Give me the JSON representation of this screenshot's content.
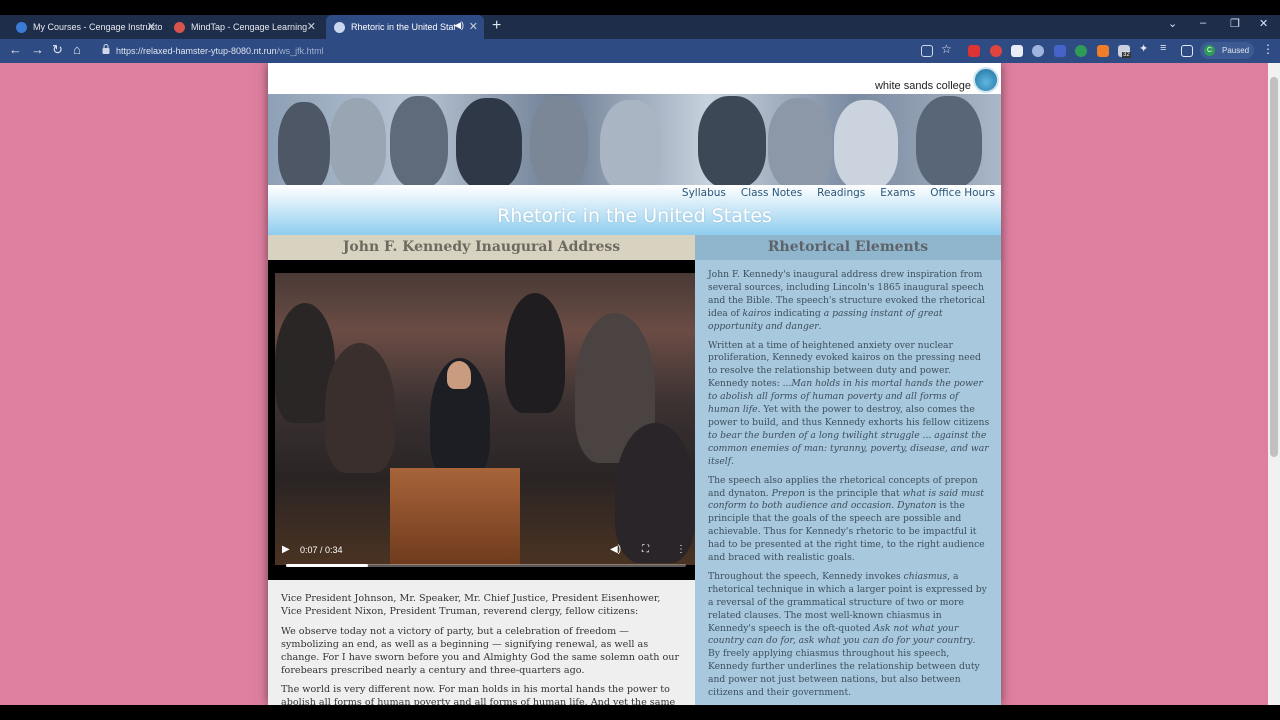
{
  "browser": {
    "tabs": [
      {
        "title": "My Courses - Cengage Instructor",
        "active": false
      },
      {
        "title": "MindTap - Cengage Learning",
        "active": false
      },
      {
        "title": "Rhetoric in the United States",
        "active": true
      }
    ],
    "url_host": "https://relaxed-hamster-ytup-8080.nt.run",
    "url_path": "/ws_jfk.html",
    "profile_initial": "C",
    "profile_status": "Paused",
    "extension_badge": "32"
  },
  "site": {
    "college_name": "white sands college",
    "title": "Rhetoric in the United States",
    "nav": [
      "Syllabus",
      "Class Notes",
      "Readings",
      "Exams",
      "Office Hours"
    ]
  },
  "left_column": {
    "heading": "John F. Kennedy Inaugural Address",
    "video": {
      "time": "0:07 / 0:34",
      "progress": 0.206
    },
    "speech": [
      "Vice President Johnson, Mr. Speaker, Mr. Chief Justice, President Eisenhower, Vice President Nixon, President Truman, reverend clergy, fellow citizens:",
      "We observe today not a victory of party, but a celebration of freedom — symbolizing an end, as well as a beginning — signifying renewal, as well as change. For I have sworn before you and Almighty God the same solemn oath our forebears prescribed nearly a century and three-quarters ago.",
      "The world is very different now. For man holds in his mortal hands the power to abolish all forms of human poverty and all forms of human life. And yet the same"
    ]
  },
  "right_column": {
    "heading": "Rhetorical Elements",
    "paragraphs": [
      {
        "segments": [
          {
            "text": "John F. Kennedy's inaugural address drew inspiration from several sources, including Lincoln's 1865 inaugural speech and the Bible. The speech's structure evoked the rhetorical idea of ",
            "italic": false
          },
          {
            "text": "kairos",
            "italic": true
          },
          {
            "text": " indicating ",
            "italic": false
          },
          {
            "text": "a passing instant of great opportunity and danger",
            "italic": true
          },
          {
            "text": ".",
            "italic": false
          }
        ]
      },
      {
        "segments": [
          {
            "text": "Written at a time of heightened anxiety over nuclear proliferation, Kennedy evoked kairos on the pressing need to resolve the relationship between duty and power. Kennedy notes: ...",
            "italic": false
          },
          {
            "text": "Man holds in his mortal hands the power to abolish all forms of human poverty and all forms of human life",
            "italic": true
          },
          {
            "text": ". Yet with the power to destroy, also comes the power to build, and thus Kennedy exhorts his fellow citizens ",
            "italic": false
          },
          {
            "text": "to bear the burden of a long twilight struggle ... against the common enemies of man: tyranny, poverty, disease, and war itself",
            "italic": true
          },
          {
            "text": ".",
            "italic": false
          }
        ]
      },
      {
        "segments": [
          {
            "text": "The speech also applies the rhetorical concepts of prepon and dynaton. ",
            "italic": false
          },
          {
            "text": "Prepon",
            "italic": true
          },
          {
            "text": " is the principle that ",
            "italic": false
          },
          {
            "text": "what is said must conform to both audience and occasion. Dynaton",
            "italic": true
          },
          {
            "text": " is the principle that the goals of the speech are possible and achievable. Thus for Kennedy's rhetoric to be impactful it had to be presented at the right time, to the right audience and braced with realistic goals.",
            "italic": false
          }
        ]
      },
      {
        "segments": [
          {
            "text": "Throughout the speech, Kennedy invokes ",
            "italic": false
          },
          {
            "text": "chiasmus",
            "italic": true
          },
          {
            "text": ", a rhetorical technique in which a larger point is expressed by a reversal of the grammatical structure of two or more related clauses. The most well-known chiasmus in Kennedy's speech is the oft-quoted ",
            "italic": false
          },
          {
            "text": "Ask not what your country can do for, ask what you can do for your country",
            "italic": true
          },
          {
            "text": ". By freely applying chiasmus throughout his speech, Kennedy further underlines the relationship between duty and power not just between nations, but also between citizens and their government.",
            "italic": false
          }
        ]
      }
    ]
  },
  "colors": {
    "background": "#df7fa0",
    "chrome": "#2f4b83",
    "left_bg": "#efefef",
    "right_bg": "#a7c8dd"
  }
}
